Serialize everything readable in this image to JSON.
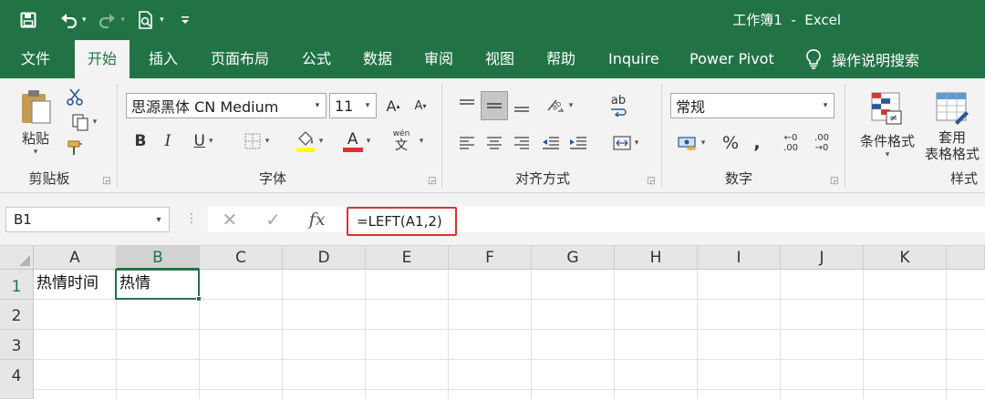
{
  "titlebar": {
    "title": "工作簿1  -  Excel",
    "bg_color": "#217346"
  },
  "tabs": {
    "items": [
      "文件",
      "开始",
      "插入",
      "页面布局",
      "公式",
      "数据",
      "审阅",
      "视图",
      "帮助",
      "Inquire",
      "Power Pivot"
    ],
    "active": "开始",
    "search_label": "操作说明搜索"
  },
  "ribbon": {
    "clipboard": {
      "paste_label": "粘贴",
      "group_label": "剪贴板"
    },
    "font": {
      "font_name": "思源黑体 CN Medium",
      "font_size": "11",
      "grow_label": "A",
      "shrink_label": "A",
      "bold_label": "B",
      "italic_label": "I",
      "underline_label": "U",
      "font_color_label": "A",
      "wen_label": "wén",
      "wen_char": "文",
      "group_label": "字体",
      "fill_color": "#ffff00",
      "font_color": "#e03131"
    },
    "alignment": {
      "ab_label": "ab",
      "group_label": "对齐方式"
    },
    "number": {
      "format": "常规",
      "percent_label": "%",
      "comma_label": ",",
      "inc_label": "←0 .00",
      "dec_label": ".00 →0",
      "group_label": "数字"
    },
    "styles": {
      "conditional_label": "条件格式",
      "table_label_1": "套用",
      "table_label_2": "表格格式",
      "group_label": "样式"
    }
  },
  "formula_bar": {
    "name_box": "B1",
    "fx_label": "fx",
    "formula": "=LEFT(A1,2)",
    "highlight_color": "#e03131"
  },
  "grid": {
    "columns": [
      "A",
      "B",
      "C",
      "D",
      "E",
      "F",
      "G",
      "H",
      "I",
      "J",
      "K"
    ],
    "rows": [
      "1",
      "2",
      "3",
      "4"
    ],
    "selected_cell": "B1",
    "cells": {
      "A1": "热情时间",
      "B1": "热情"
    }
  }
}
